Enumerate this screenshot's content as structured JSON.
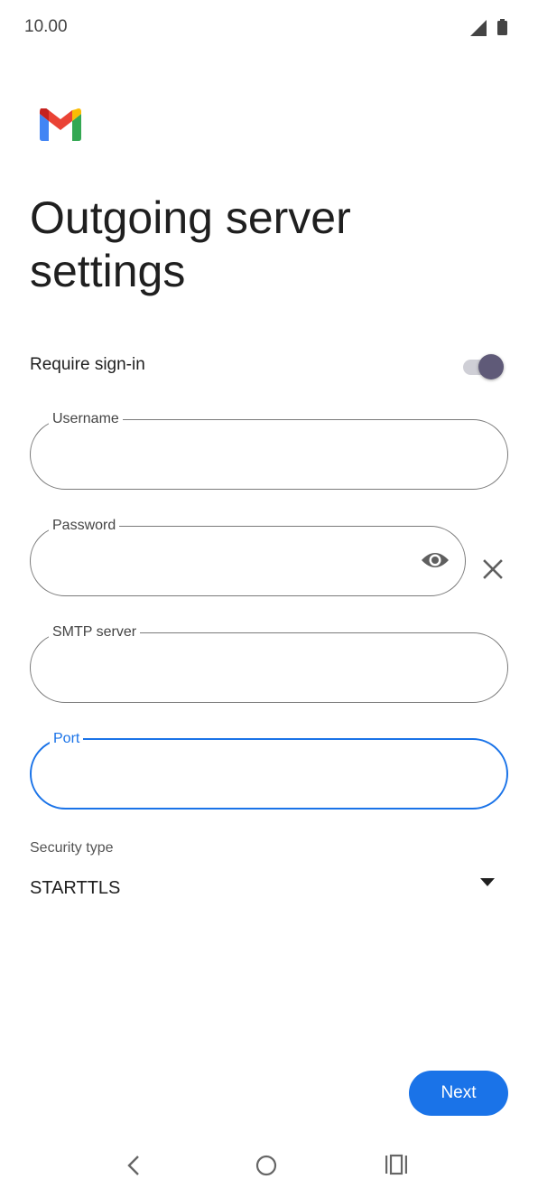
{
  "status_bar": {
    "time": "10.00",
    "icons": [
      "signal-icon",
      "battery-icon"
    ]
  },
  "header": {
    "logo": "gmail-logo",
    "title": "Outgoing server settings"
  },
  "form": {
    "require_signin": {
      "label": "Require sign-in",
      "enabled": true
    },
    "username": {
      "label": "Username",
      "value": ""
    },
    "password": {
      "label": "Password",
      "value": "",
      "icons": [
        "eye-icon",
        "close-icon"
      ]
    },
    "smtp_server": {
      "label": "SMTP server",
      "value": ""
    },
    "port": {
      "label": "Port",
      "value": "",
      "focused": true
    },
    "security_type": {
      "label": "Security type",
      "value": "STARTTLS"
    }
  },
  "actions": {
    "next_label": "Next"
  },
  "nav_bar": {
    "icons": [
      "back-icon",
      "home-icon",
      "recents-icon"
    ]
  },
  "colors": {
    "accent": "#1a73e8",
    "toggle_thumb": "#5f5a78"
  }
}
